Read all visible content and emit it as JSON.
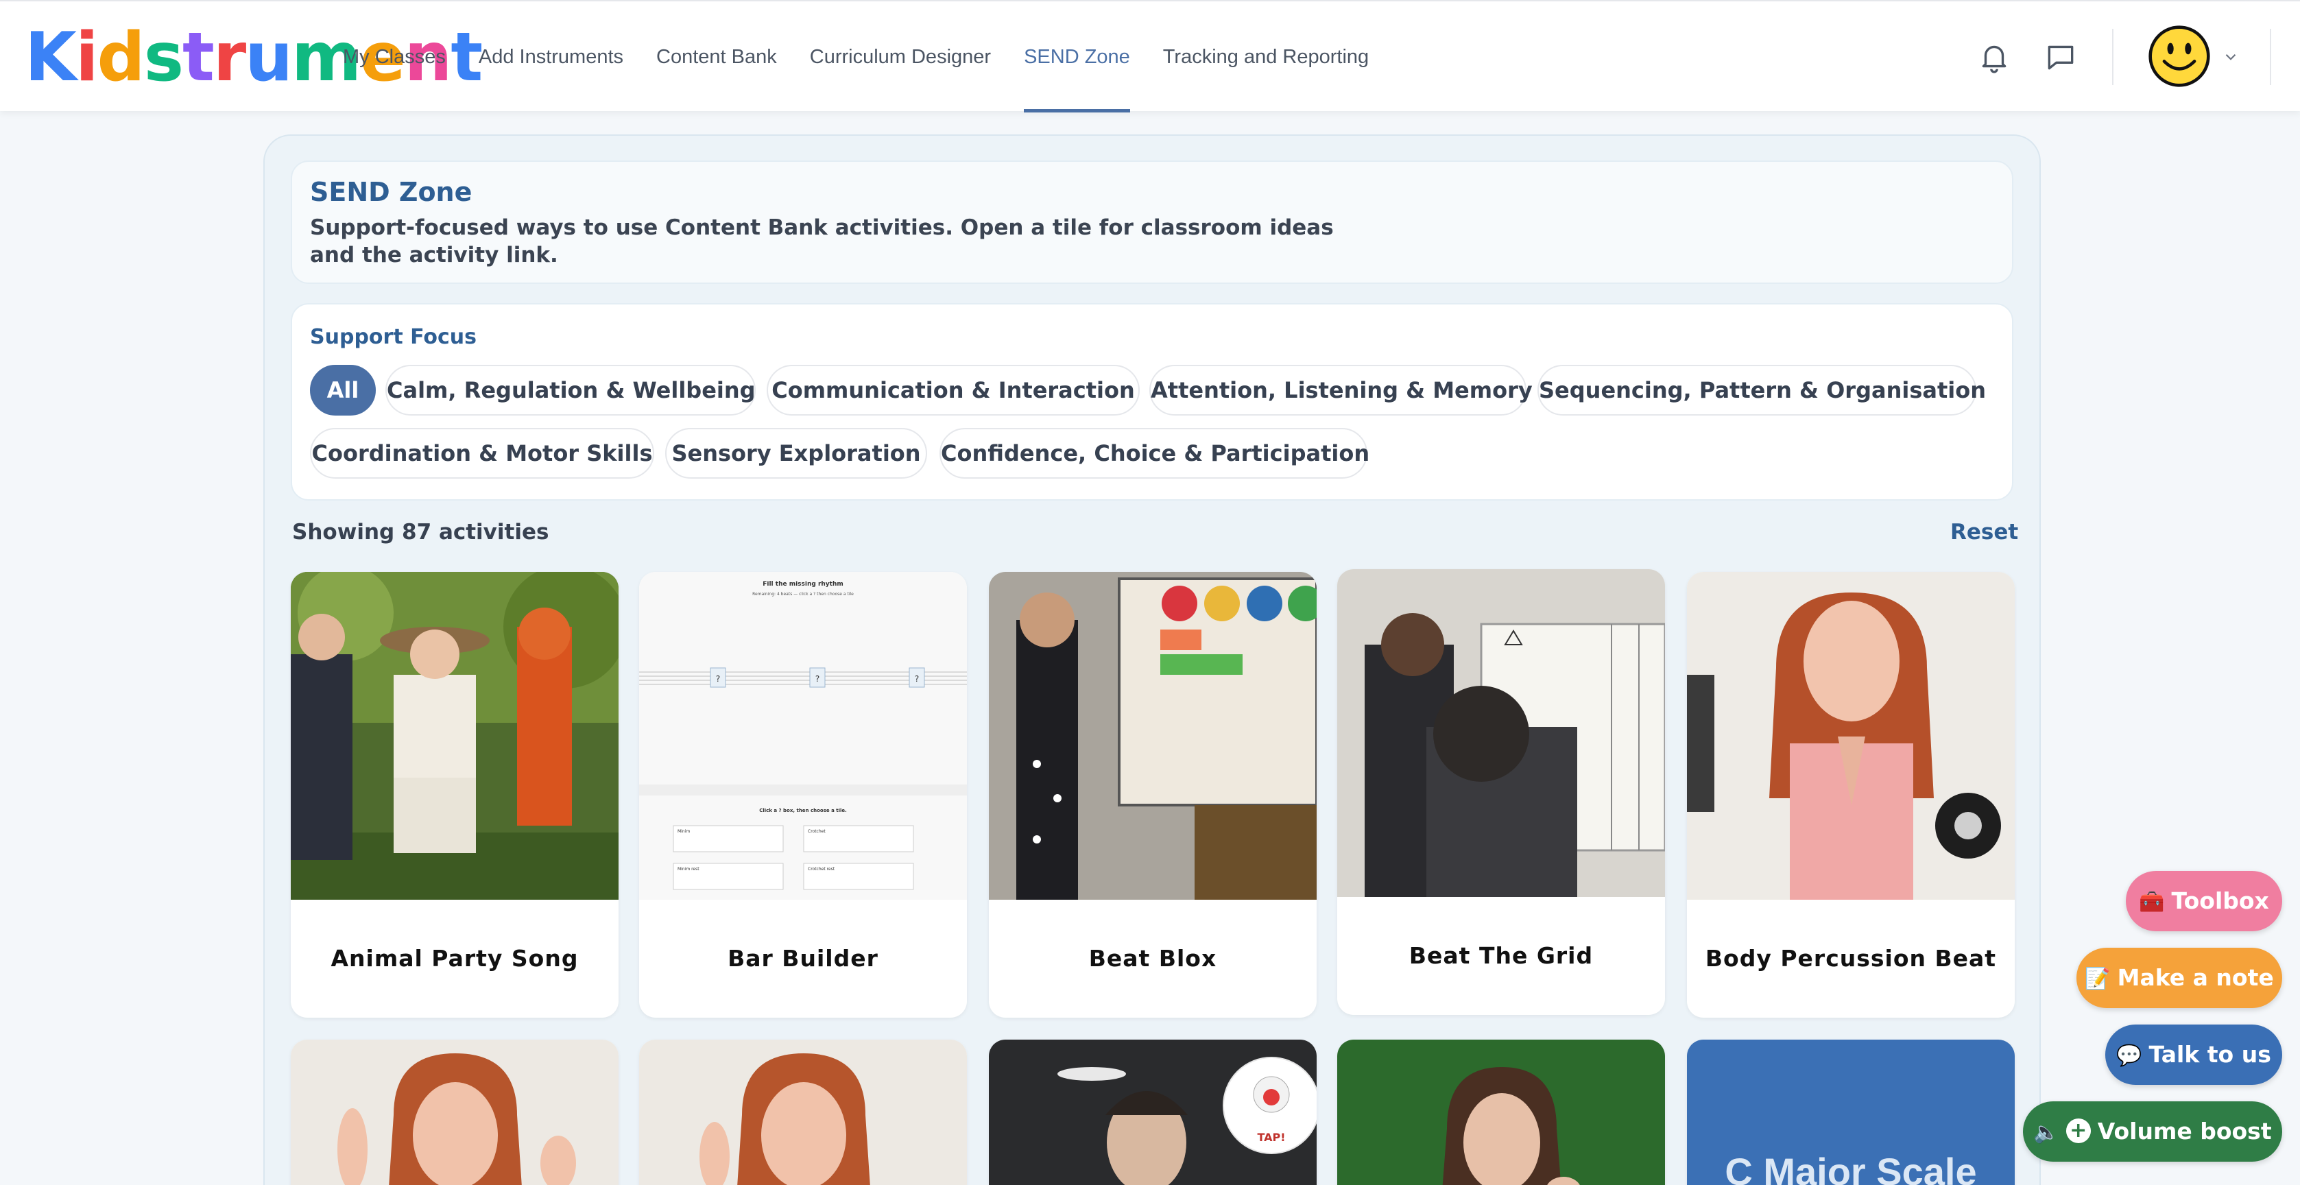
{
  "brand": {
    "letters": [
      "K",
      "i",
      "d",
      "s",
      "t",
      "r",
      "u",
      "m",
      "e",
      "n",
      "t"
    ],
    "colors": [
      "#3b82f6",
      "#ef4444",
      "#f59e0b",
      "#10b981",
      "#8b5cf6",
      "#ef4444",
      "#3b82f6",
      "#10b981",
      "#f59e0b",
      "#ec4899",
      "#3b82f6"
    ]
  },
  "nav": {
    "links": [
      {
        "label": "My Classes"
      },
      {
        "label": "Add Instruments"
      },
      {
        "label": "Content Bank"
      },
      {
        "label": "Curriculum Designer"
      },
      {
        "label": "SEND Zone"
      },
      {
        "label": "Tracking and Reporting"
      }
    ],
    "active_index": 4,
    "icons": [
      "bell-icon",
      "chat-icon",
      "avatar",
      "chevron-down-icon"
    ]
  },
  "hero": {
    "title": "SEND Zone",
    "description": "Support-focused ways to use Content Bank activities. Open a tile for classroom ideas and the activity link."
  },
  "focus": {
    "title": "Support Focus",
    "chips": [
      {
        "label": "All",
        "active": true
      },
      {
        "label": "Calm, Regulation & Wellbeing"
      },
      {
        "label": "Communication & Interaction"
      },
      {
        "label": "Attention, Listening & Memory"
      },
      {
        "label": "Sequencing, Pattern & Organisation"
      },
      {
        "label": "Coordination & Motor Skills"
      },
      {
        "label": "Sensory Exploration"
      },
      {
        "label": "Confidence, Choice & Participation"
      }
    ]
  },
  "results": {
    "count_text": "Showing 87 activities",
    "reset_label": "Reset"
  },
  "tiles": [
    {
      "title": "Animal Party Song"
    },
    {
      "title": "Bar Builder"
    },
    {
      "title": "Beat Blox"
    },
    {
      "title": "Beat The Grid"
    },
    {
      "title": "Body Percussion Beat"
    },
    {
      "title": ""
    },
    {
      "title": ""
    },
    {
      "title": ""
    },
    {
      "title": ""
    },
    {
      "title": "C Major Scale"
    }
  ],
  "bar_builder": {
    "heading": "Fill the missing rhythm",
    "sub": "Remaining: 4 beats — click a ? then choose a tile",
    "instruction": "Click a ? box, then choose a tile.",
    "cells": [
      "Minim",
      "Crotchet",
      "Minim rest",
      "Crotchet rest"
    ]
  },
  "tap_badge": "TAP!",
  "fabs": {
    "toolbox": "Toolbox",
    "note": "Make a note",
    "talk": "Talk to us",
    "volume": "Volume boost"
  },
  "colors": {
    "accent": "#4a6fa5",
    "heading": "#2e5e93"
  }
}
